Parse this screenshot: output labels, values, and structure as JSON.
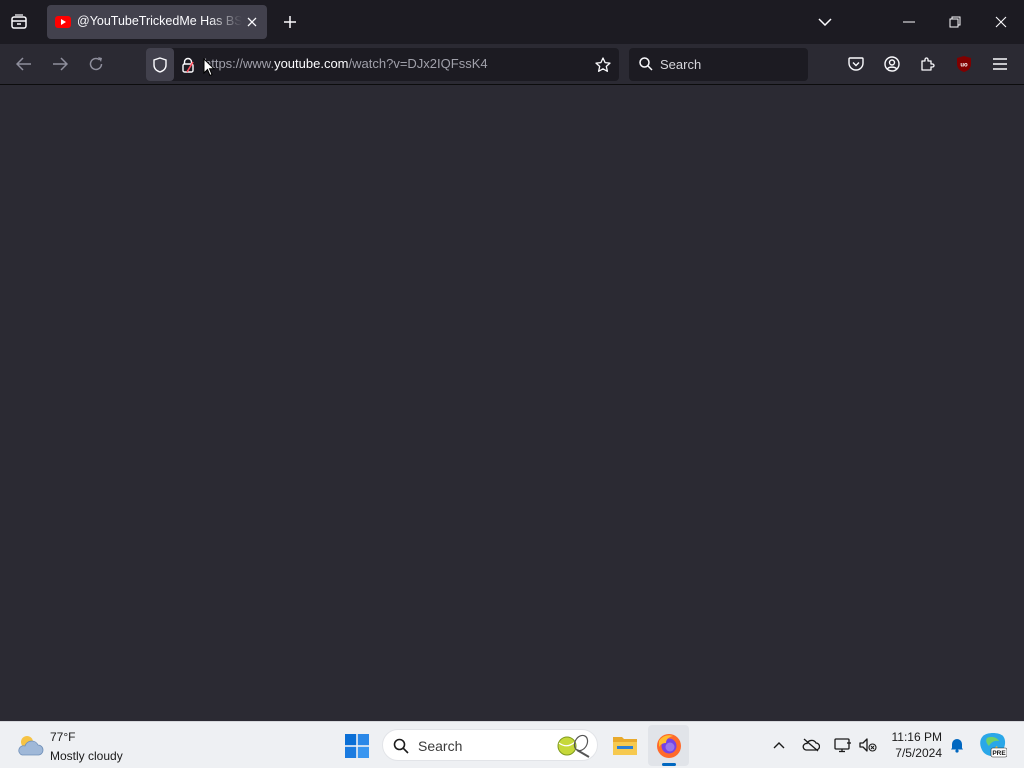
{
  "browser": {
    "tab": {
      "title": "@YouTubeTrickedMe Has BSOD",
      "favicon": "youtube-favicon"
    },
    "urlbar": {
      "protocol_prefix": "https://www.",
      "domain": "youtube.com",
      "path": "/watch?v=DJx2IQFssK4"
    },
    "search": {
      "placeholder": "Search"
    },
    "extension_badge": "uo"
  },
  "taskbar": {
    "weather": {
      "temperature": "77°F",
      "condition": "Mostly cloudy"
    },
    "search": {
      "placeholder": "Search"
    },
    "clock": {
      "time": "11:16 PM",
      "date": "7/5/2024"
    },
    "copilot_badge": "PRE"
  },
  "colors": {
    "chrome_dark": "#1c1b22",
    "toolbar": "#2b2a33",
    "tab_active": "#42414d",
    "youtube_red": "#ff0000",
    "windows_blue": "#0067c0"
  }
}
